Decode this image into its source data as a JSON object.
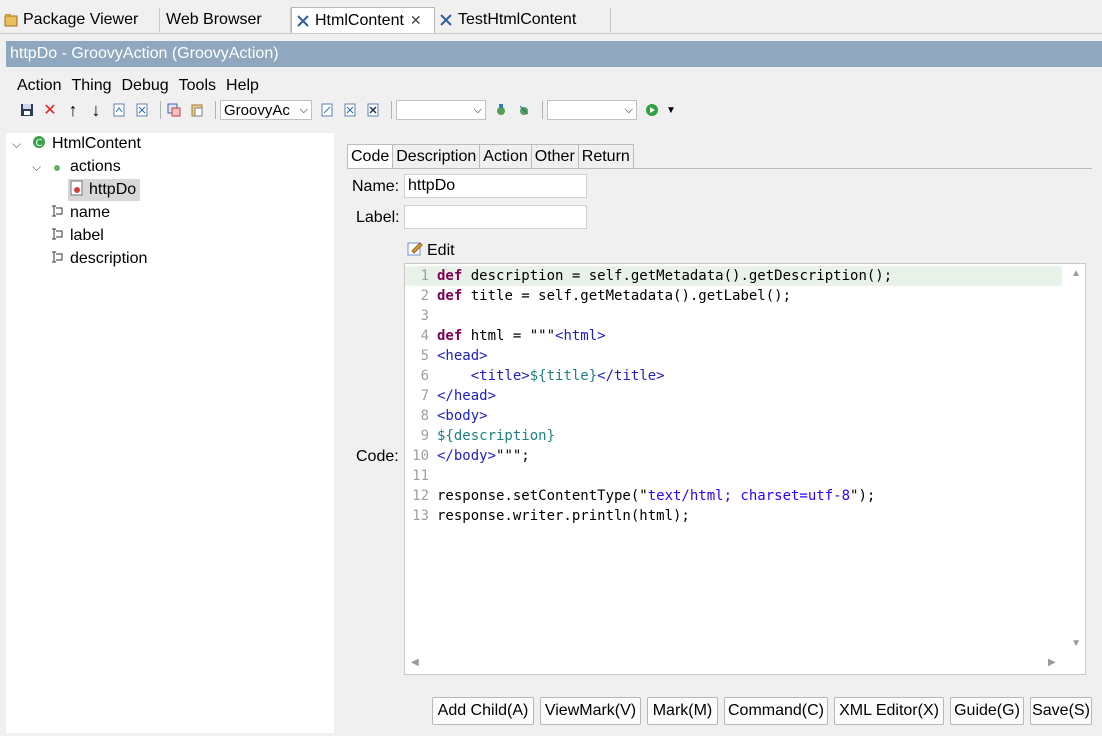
{
  "tabs": [
    {
      "label": "Package Viewer",
      "icon": "package-icon"
    },
    {
      "label": "Web Browser",
      "icon": ""
    },
    {
      "label": "HtmlContent",
      "icon": "thing-icon",
      "active": true,
      "closable": true
    },
    {
      "label": "TestHtmlContent",
      "icon": "thing-icon"
    }
  ],
  "window_title": "httpDo - GroovyAction  (GroovyAction)",
  "menu": [
    "Action",
    "Thing",
    "Debug",
    "Tools",
    "Help"
  ],
  "toolbar": {
    "class_combo": "GroovyAc",
    "combo2": "",
    "combo3": ""
  },
  "tree": {
    "root": "HtmlContent",
    "actions": "actions",
    "httpdo": "httpDo",
    "attrs": [
      "name",
      "label",
      "description"
    ]
  },
  "subtabs": [
    "Code",
    "Description",
    "Action",
    "Other",
    "Return"
  ],
  "form": {
    "name_label": "Name:",
    "name_value": "httpDo",
    "label_label": "Label:",
    "label_value": "",
    "edit_label": "Edit",
    "code_label": "Code:"
  },
  "code_lines": [
    "def description = self.getMetadata().getDescription();",
    "def title = self.getMetadata().getLabel();",
    "",
    "def html = \"\"\"<html>",
    "<head>",
    "    <title>${title}</title>",
    "</head>",
    "<body>",
    "${description}",
    "</body>\"\"\";",
    "",
    "response.setContentType(\"text/html; charset=utf-8\");",
    "response.writer.println(html);"
  ],
  "buttons": [
    "Add Child(A)",
    "ViewMark(V)",
    "Mark(M)",
    "Command(C)",
    "XML Editor(X)",
    "Guide(G)",
    "Save(S)"
  ],
  "colors": {
    "title_bar": "#8fa8c0",
    "keyword": "#7f0055",
    "string": "#2a00ff"
  }
}
